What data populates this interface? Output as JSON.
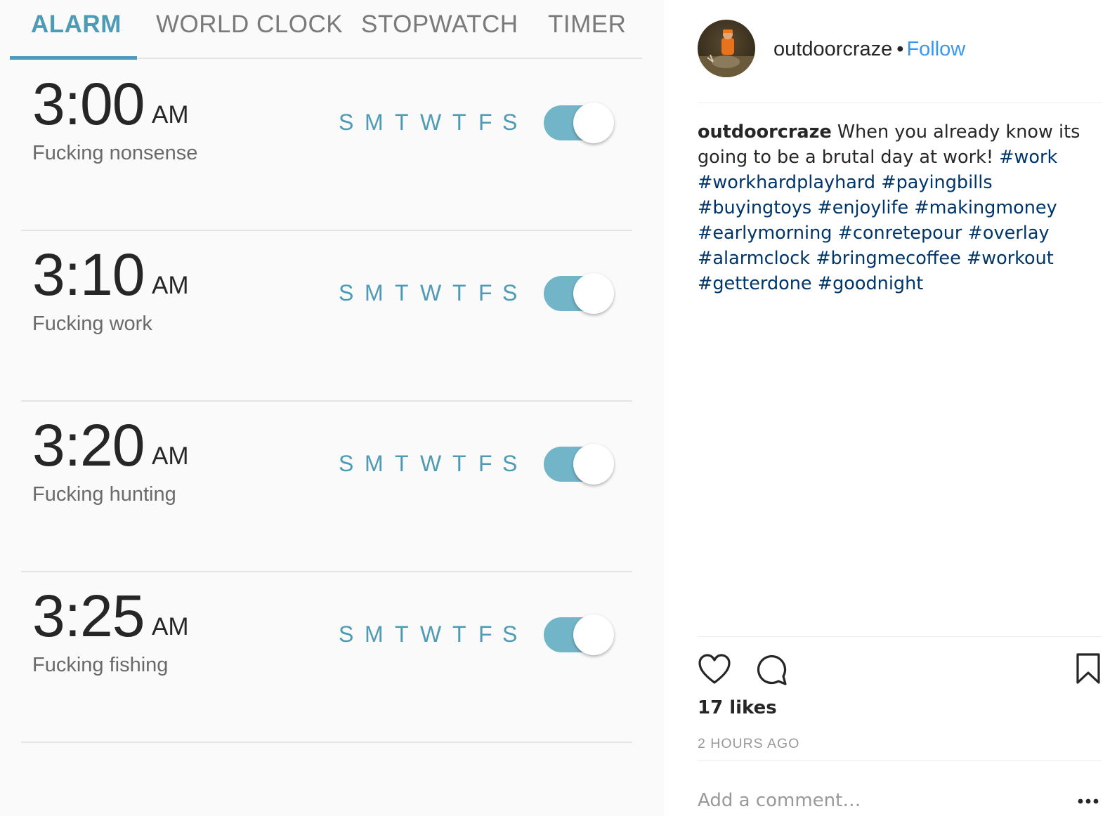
{
  "alarm_app": {
    "tabs": [
      {
        "label": "ALARM",
        "active": true
      },
      {
        "label": "WORLD CLOCK",
        "active": false
      },
      {
        "label": "STOPWATCH",
        "active": false
      },
      {
        "label": "TIMER",
        "active": false
      }
    ],
    "accent_color": "#4d9bb4",
    "alarms": [
      {
        "time": "3:00",
        "ampm": "AM",
        "label": "Fucking nonsense",
        "days": [
          "S",
          "M",
          "T",
          "W",
          "T",
          "F",
          "S"
        ],
        "enabled": true
      },
      {
        "time": "3:10",
        "ampm": "AM",
        "label": "Fucking work",
        "days": [
          "S",
          "M",
          "T",
          "W",
          "T",
          "F",
          "S"
        ],
        "enabled": true
      },
      {
        "time": "3:20",
        "ampm": "AM",
        "label": "Fucking hunting",
        "days": [
          "S",
          "M",
          "T",
          "W",
          "T",
          "F",
          "S"
        ],
        "enabled": true
      },
      {
        "time": "3:25",
        "ampm": "AM",
        "label": "Fucking fishing",
        "days": [
          "S",
          "M",
          "T",
          "W",
          "T",
          "F",
          "S"
        ],
        "enabled": true
      }
    ]
  },
  "post": {
    "username": "outdoorcraze",
    "separator": "•",
    "follow_label": "Follow",
    "caption_text": "When you already know its going to be a brutal day at work!",
    "hashtags": [
      "#work",
      "#workhardplayhard",
      "#payingbills",
      "#buyingtoys",
      "#enjoylife",
      "#makingmoney",
      "#earlymorning",
      "#conretepour",
      "#overlay",
      "#alarmclock",
      "#bringmecoffee",
      "#workout",
      "#getterdone",
      "#goodnight"
    ],
    "likes": "17 likes",
    "timestamp": "2 HOURS AGO",
    "comment_placeholder": "Add a comment…",
    "icons": {
      "like": "heart-icon",
      "comment": "comment-bubble-icon",
      "save": "bookmark-icon",
      "more": "ellipsis-icon"
    },
    "link_color": "#3897f0",
    "hashtag_color": "#003569"
  }
}
